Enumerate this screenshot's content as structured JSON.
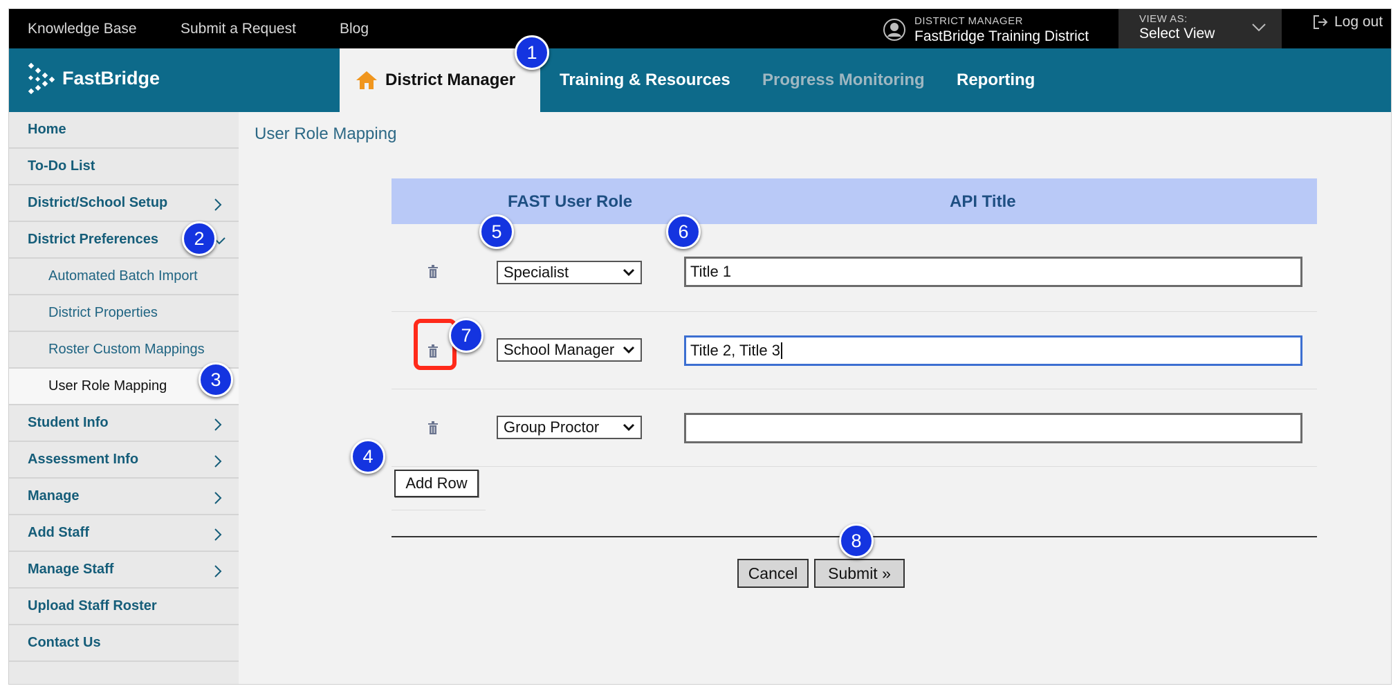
{
  "topbar": {
    "links": [
      "Knowledge Base",
      "Submit a Request",
      "Blog"
    ],
    "role_label": "DISTRICT MANAGER",
    "district_name": "FastBridge Training District",
    "view_as_label": "VIEW AS:",
    "view_as_value": "Select View",
    "logout_label": "Log out"
  },
  "header": {
    "logo_text": "FastBridge",
    "tabs": [
      {
        "label": "District Manager",
        "active": true
      },
      {
        "label": "Training & Resources",
        "active": false
      },
      {
        "label": "Progress Monitoring",
        "active": false,
        "disabled": true
      },
      {
        "label": "Reporting",
        "active": false
      }
    ]
  },
  "sidebar": {
    "items": [
      {
        "label": "Home"
      },
      {
        "label": "To-Do List"
      },
      {
        "label": "District/School Setup"
      },
      {
        "label": "District Preferences"
      },
      {
        "label": "Automated Batch Import"
      },
      {
        "label": "District Properties"
      },
      {
        "label": "Roster Custom Mappings"
      },
      {
        "label": "User Role Mapping"
      },
      {
        "label": "Student Info"
      },
      {
        "label": "Assessment Info"
      },
      {
        "label": "Manage"
      },
      {
        "label": "Add Staff"
      },
      {
        "label": "Manage Staff"
      },
      {
        "label": "Upload Staff Roster"
      },
      {
        "label": "Contact Us"
      }
    ]
  },
  "main": {
    "title": "User Role Mapping",
    "columns": [
      "FAST User Role",
      "API Title"
    ],
    "rows": [
      {
        "role": "Specialist",
        "api_title": "Title 1"
      },
      {
        "role": "School Manager",
        "api_title": "Title 2, Title 3"
      },
      {
        "role": "Group Proctor",
        "api_title": ""
      }
    ],
    "add_row_label": "Add Row",
    "cancel_label": "Cancel",
    "submit_label": "Submit »"
  },
  "callouts": [
    "1",
    "2",
    "3",
    "4",
    "5",
    "6",
    "7",
    "8"
  ],
  "colors": {
    "header_teal": "#0d6a8a",
    "callout_blue": "#1434e0",
    "highlight_red": "#ff2a1a",
    "table_header": "#b9c9f7"
  }
}
